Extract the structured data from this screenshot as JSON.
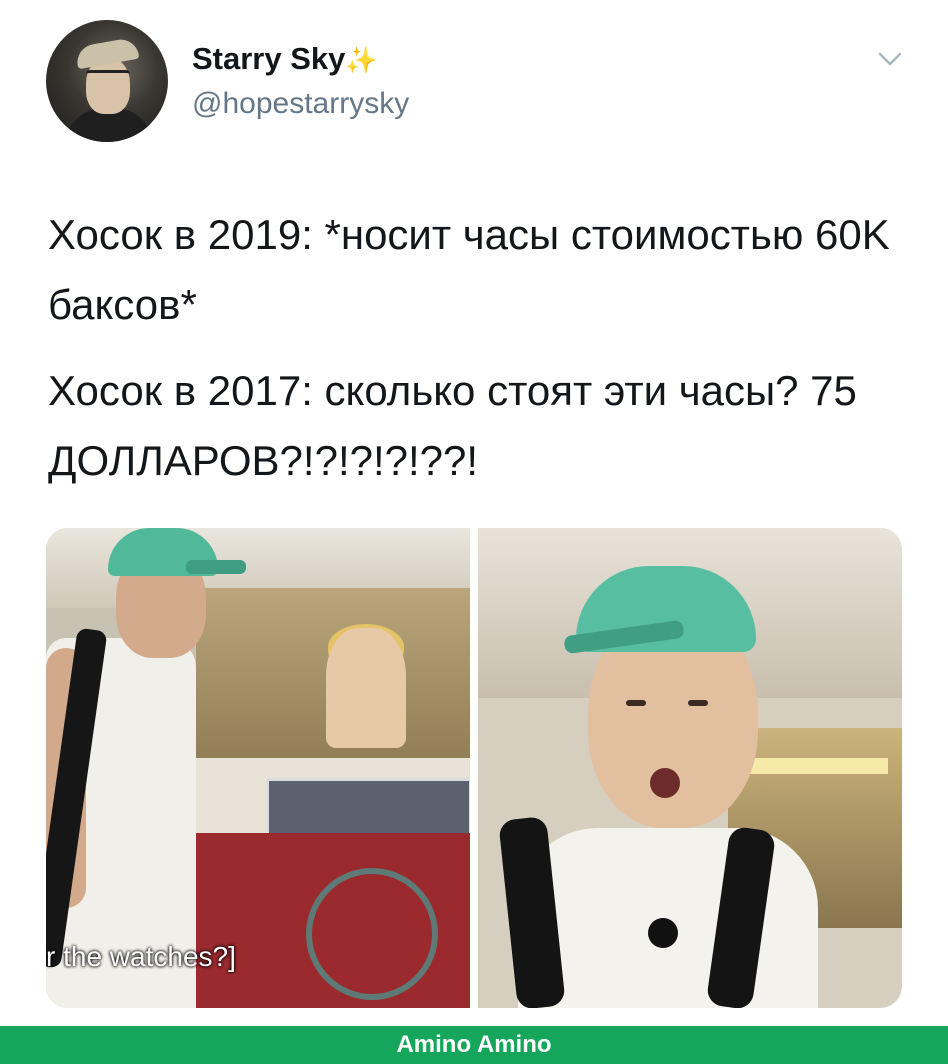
{
  "tweet": {
    "display_name": "Starry Sky",
    "name_emoji": "✨",
    "handle": "@hopestarrysky",
    "lines": [
      "Хосок в 2019:  *носит часы стоимостью 60K баксов*",
      "Хосок в 2017:  сколько стоят эти часы? 75 ДОЛЛАРОВ?!?!?!?!??!"
    ]
  },
  "media": {
    "left_caption": "r the watches?]"
  },
  "footer": {
    "label": "Amino Amino",
    "color": "#15a65b"
  },
  "icons": {
    "menu": "chevron-down-icon",
    "sparkles": "sparkles-icon"
  }
}
